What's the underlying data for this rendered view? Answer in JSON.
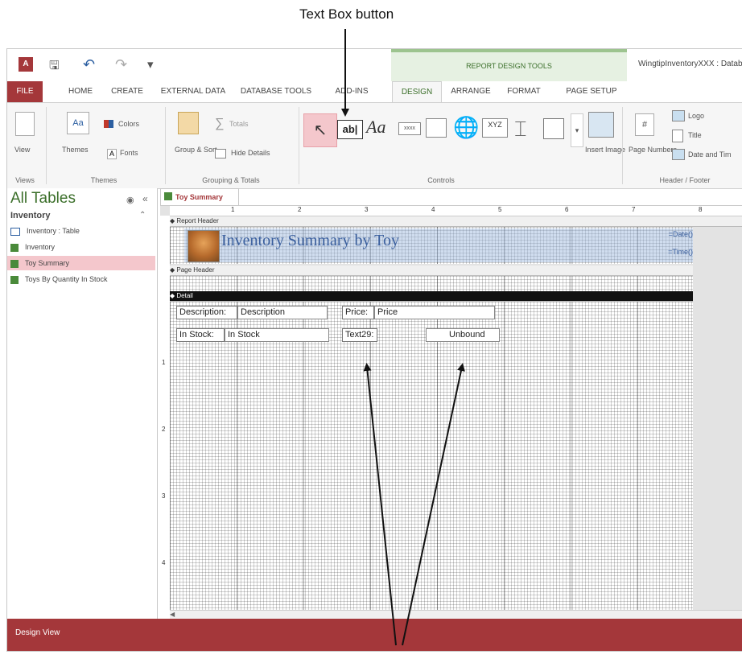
{
  "callout": {
    "label": "Text Box button"
  },
  "window": {
    "title": "WingtipInventoryXXX : Datab",
    "context_tab_group": "REPORT DESIGN TOOLS"
  },
  "tabs": [
    "FILE",
    "HOME",
    "CREATE",
    "EXTERNAL DATA",
    "DATABASE TOOLS",
    "ADD-INS",
    "DESIGN",
    "ARRANGE",
    "FORMAT",
    "PAGE SETUP"
  ],
  "ribbon": {
    "view": {
      "label": "View",
      "group": "Views"
    },
    "themes": {
      "themes": "Themes",
      "colors": "Colors",
      "fonts": "Fonts",
      "group": "Themes"
    },
    "grouping": {
      "group_sort": "Group & Sort",
      "totals": "Totals",
      "hide_details": "Hide Details",
      "group": "Grouping & Totals"
    },
    "controls": {
      "group": "Controls",
      "text_box": "ab|",
      "label": "Aa",
      "button": "xxxx",
      "chart": "XYZ"
    },
    "insert_image": "Insert Image",
    "header_footer": {
      "page_numbers": "Page Numbers",
      "logo": "Logo",
      "title": "Title",
      "date_time": "Date and Tim",
      "group": "Header / Footer"
    }
  },
  "nav": {
    "title": "All Tables",
    "group": "Inventory",
    "items": [
      "Inventory : Table",
      "Inventory",
      "Toy Summary",
      "Toys By Quantity In Stock"
    ],
    "selected_index": 2
  },
  "document": {
    "tab": "Toy Summary",
    "ruler_marks": [
      "1",
      "2",
      "3",
      "4",
      "5",
      "6",
      "7",
      "8"
    ],
    "vruler_marks": [
      "1",
      "2",
      "3",
      "4"
    ],
    "sections": {
      "report_header": "Report Header",
      "page_header": "Page Header",
      "detail": "Detail"
    },
    "title": "Inventory Summary by Toy",
    "date_expr": "=Date()",
    "time_expr": "=Time()",
    "controls": {
      "description_label": "Description:",
      "description_box": "Description",
      "price_label": "Price:",
      "price_box": "Price",
      "instock_label": "In Stock:",
      "instock_box": "In Stock",
      "new_label": "Text29:",
      "new_box": "Unbound"
    }
  },
  "status": {
    "text": "Design View"
  },
  "colors": {
    "accent_red": "#a4373a",
    "accent_green": "#3b6f2a",
    "detail_bar": "#111111",
    "header_fill": "#c5d5ea"
  }
}
